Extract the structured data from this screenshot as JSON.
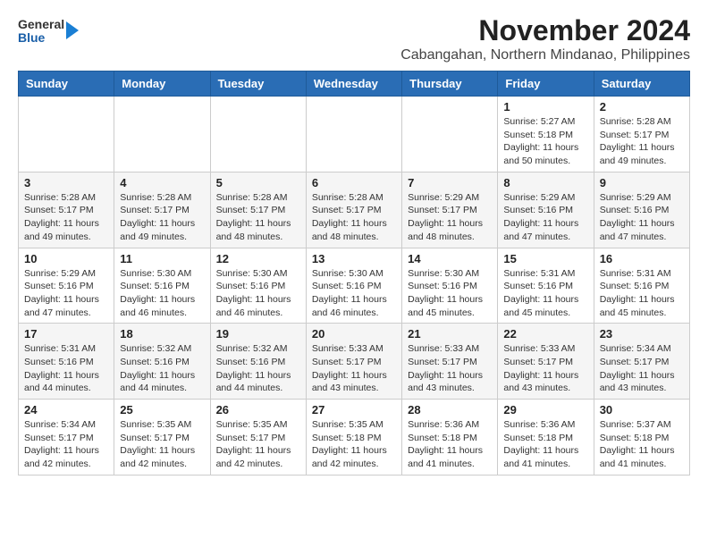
{
  "header": {
    "logo_general": "General",
    "logo_blue": "Blue",
    "title": "November 2024",
    "subtitle": "Cabangahan, Northern Mindanao, Philippines"
  },
  "weekdays": [
    "Sunday",
    "Monday",
    "Tuesday",
    "Wednesday",
    "Thursday",
    "Friday",
    "Saturday"
  ],
  "weeks": [
    [
      {
        "day": "",
        "info": ""
      },
      {
        "day": "",
        "info": ""
      },
      {
        "day": "",
        "info": ""
      },
      {
        "day": "",
        "info": ""
      },
      {
        "day": "",
        "info": ""
      },
      {
        "day": "1",
        "info": "Sunrise: 5:27 AM\nSunset: 5:18 PM\nDaylight: 11 hours\nand 50 minutes."
      },
      {
        "day": "2",
        "info": "Sunrise: 5:28 AM\nSunset: 5:17 PM\nDaylight: 11 hours\nand 49 minutes."
      }
    ],
    [
      {
        "day": "3",
        "info": "Sunrise: 5:28 AM\nSunset: 5:17 PM\nDaylight: 11 hours\nand 49 minutes."
      },
      {
        "day": "4",
        "info": "Sunrise: 5:28 AM\nSunset: 5:17 PM\nDaylight: 11 hours\nand 49 minutes."
      },
      {
        "day": "5",
        "info": "Sunrise: 5:28 AM\nSunset: 5:17 PM\nDaylight: 11 hours\nand 48 minutes."
      },
      {
        "day": "6",
        "info": "Sunrise: 5:28 AM\nSunset: 5:17 PM\nDaylight: 11 hours\nand 48 minutes."
      },
      {
        "day": "7",
        "info": "Sunrise: 5:29 AM\nSunset: 5:17 PM\nDaylight: 11 hours\nand 48 minutes."
      },
      {
        "day": "8",
        "info": "Sunrise: 5:29 AM\nSunset: 5:16 PM\nDaylight: 11 hours\nand 47 minutes."
      },
      {
        "day": "9",
        "info": "Sunrise: 5:29 AM\nSunset: 5:16 PM\nDaylight: 11 hours\nand 47 minutes."
      }
    ],
    [
      {
        "day": "10",
        "info": "Sunrise: 5:29 AM\nSunset: 5:16 PM\nDaylight: 11 hours\nand 47 minutes."
      },
      {
        "day": "11",
        "info": "Sunrise: 5:30 AM\nSunset: 5:16 PM\nDaylight: 11 hours\nand 46 minutes."
      },
      {
        "day": "12",
        "info": "Sunrise: 5:30 AM\nSunset: 5:16 PM\nDaylight: 11 hours\nand 46 minutes."
      },
      {
        "day": "13",
        "info": "Sunrise: 5:30 AM\nSunset: 5:16 PM\nDaylight: 11 hours\nand 46 minutes."
      },
      {
        "day": "14",
        "info": "Sunrise: 5:30 AM\nSunset: 5:16 PM\nDaylight: 11 hours\nand 45 minutes."
      },
      {
        "day": "15",
        "info": "Sunrise: 5:31 AM\nSunset: 5:16 PM\nDaylight: 11 hours\nand 45 minutes."
      },
      {
        "day": "16",
        "info": "Sunrise: 5:31 AM\nSunset: 5:16 PM\nDaylight: 11 hours\nand 45 minutes."
      }
    ],
    [
      {
        "day": "17",
        "info": "Sunrise: 5:31 AM\nSunset: 5:16 PM\nDaylight: 11 hours\nand 44 minutes."
      },
      {
        "day": "18",
        "info": "Sunrise: 5:32 AM\nSunset: 5:16 PM\nDaylight: 11 hours\nand 44 minutes."
      },
      {
        "day": "19",
        "info": "Sunrise: 5:32 AM\nSunset: 5:16 PM\nDaylight: 11 hours\nand 44 minutes."
      },
      {
        "day": "20",
        "info": "Sunrise: 5:33 AM\nSunset: 5:17 PM\nDaylight: 11 hours\nand 43 minutes."
      },
      {
        "day": "21",
        "info": "Sunrise: 5:33 AM\nSunset: 5:17 PM\nDaylight: 11 hours\nand 43 minutes."
      },
      {
        "day": "22",
        "info": "Sunrise: 5:33 AM\nSunset: 5:17 PM\nDaylight: 11 hours\nand 43 minutes."
      },
      {
        "day": "23",
        "info": "Sunrise: 5:34 AM\nSunset: 5:17 PM\nDaylight: 11 hours\nand 43 minutes."
      }
    ],
    [
      {
        "day": "24",
        "info": "Sunrise: 5:34 AM\nSunset: 5:17 PM\nDaylight: 11 hours\nand 42 minutes."
      },
      {
        "day": "25",
        "info": "Sunrise: 5:35 AM\nSunset: 5:17 PM\nDaylight: 11 hours\nand 42 minutes."
      },
      {
        "day": "26",
        "info": "Sunrise: 5:35 AM\nSunset: 5:17 PM\nDaylight: 11 hours\nand 42 minutes."
      },
      {
        "day": "27",
        "info": "Sunrise: 5:35 AM\nSunset: 5:18 PM\nDaylight: 11 hours\nand 42 minutes."
      },
      {
        "day": "28",
        "info": "Sunrise: 5:36 AM\nSunset: 5:18 PM\nDaylight: 11 hours\nand 41 minutes."
      },
      {
        "day": "29",
        "info": "Sunrise: 5:36 AM\nSunset: 5:18 PM\nDaylight: 11 hours\nand 41 minutes."
      },
      {
        "day": "30",
        "info": "Sunrise: 5:37 AM\nSunset: 5:18 PM\nDaylight: 11 hours\nand 41 minutes."
      }
    ]
  ]
}
